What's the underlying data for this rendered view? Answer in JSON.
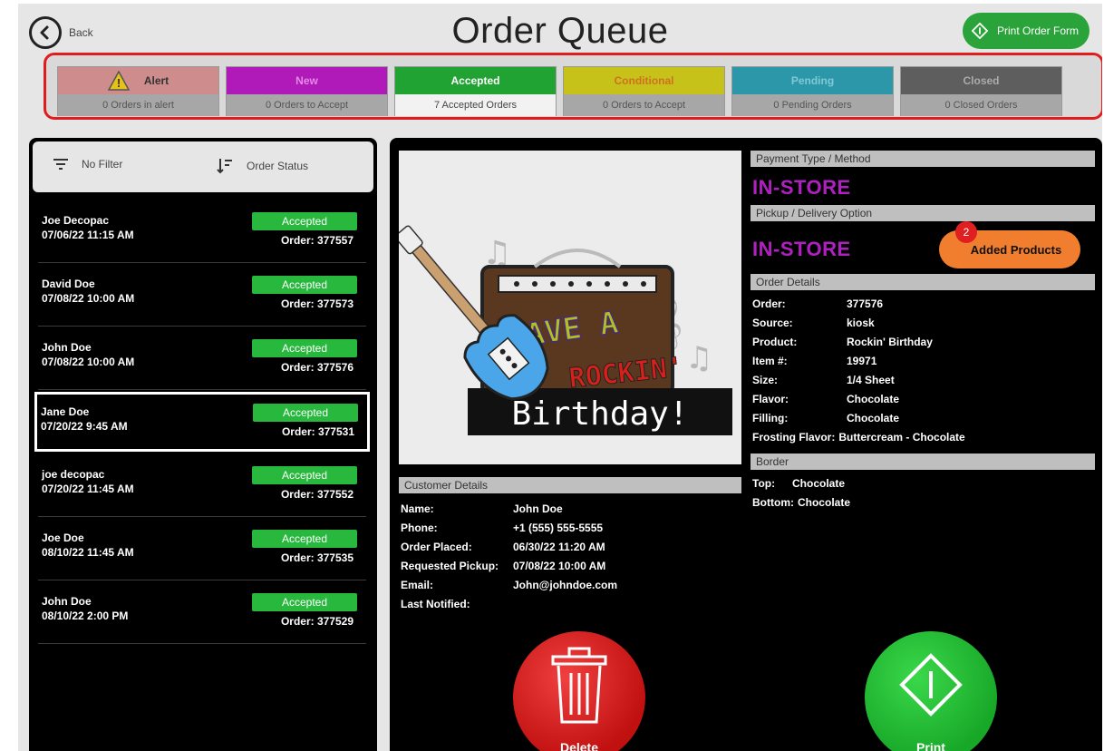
{
  "header": {
    "back_label": "Back",
    "title": "Order Queue",
    "print_form_label": "Print Order Form"
  },
  "status_tabs": [
    {
      "label": "Alert",
      "sub": "0 Orders in alert",
      "color": "#cf8c8c"
    },
    {
      "label": "New",
      "sub": "0 Orders to Accept",
      "color": "#b01ab8"
    },
    {
      "label": "Accepted",
      "sub": "7 Accepted Orders",
      "color": "#21a333"
    },
    {
      "label": "Conditional",
      "sub": "0 Orders to Accept",
      "color": "#c7c21a"
    },
    {
      "label": "Pending",
      "sub": "0 Pending Orders",
      "color": "#2c97a8"
    },
    {
      "label": "Closed",
      "sub": "0 Closed Orders",
      "color": "#5e5e5e"
    }
  ],
  "filters": {
    "filter_label": "No Filter",
    "sort_label": "Order Status"
  },
  "orders": [
    {
      "name": "Joe Decopac",
      "datetime": "07/06/22 11:15 AM",
      "status": "Accepted",
      "order": "Order: 377557"
    },
    {
      "name": "David Doe",
      "datetime": "07/08/22 10:00 AM",
      "status": "Accepted",
      "order": "Order: 377573"
    },
    {
      "name": "John Doe",
      "datetime": "07/08/22 10:00 AM",
      "status": "Accepted",
      "order": "Order: 377576"
    },
    {
      "name": "Jane Doe",
      "datetime": "07/20/22 9:45 AM",
      "status": "Accepted",
      "order": "Order: 377531"
    },
    {
      "name": "joe decopac",
      "datetime": "07/20/22 11:45 AM",
      "status": "Accepted",
      "order": "Order: 377552"
    },
    {
      "name": "Joe Doe",
      "datetime": "08/10/22 11:45 AM",
      "status": "Accepted",
      "order": "Order: 377535"
    },
    {
      "name": "John Doe",
      "datetime": "08/10/22 2:00 PM",
      "status": "Accepted",
      "order": "Order: 377529"
    }
  ],
  "selected_order_index": 3,
  "cake_image": {
    "line1": "HAVE A",
    "line2": "ROCKIN'",
    "line3": "Birthday!"
  },
  "customer": {
    "header": "Customer Details",
    "fields": [
      {
        "k": "Name:",
        "v": "John Doe"
      },
      {
        "k": "Phone:",
        "v": "+1 (555) 555-5555"
      },
      {
        "k": "Order Placed:",
        "v": "06/30/22 11:20 AM"
      },
      {
        "k": "Requested Pickup:",
        "v": "07/08/22 10:00 AM"
      },
      {
        "k": "Email:",
        "v": "John@johndoe.com"
      },
      {
        "k": "Last Notified:",
        "v": ""
      }
    ]
  },
  "payment": {
    "header": "Payment Type / Method",
    "value": "IN-STORE"
  },
  "pickup": {
    "header": "Pickup / Delivery Option",
    "value": "IN-STORE"
  },
  "added_products": {
    "label": "Added Products",
    "count": "2"
  },
  "order_details": {
    "header": "Order Details",
    "fields": [
      {
        "k": "Order:",
        "v": "377576"
      },
      {
        "k": "Source:",
        "v": "kiosk"
      },
      {
        "k": "Product:",
        "v": "Rockin' Birthday"
      },
      {
        "k": "Item #:",
        "v": "19971"
      },
      {
        "k": "Size:",
        "v": "1/4 Sheet"
      },
      {
        "k": "Flavor:",
        "v": "Chocolate"
      },
      {
        "k": "Filling:",
        "v": "Chocolate"
      }
    ],
    "frosting_label": "Frosting Flavor:",
    "frosting_value": "Buttercream - Chocolate"
  },
  "border": {
    "header": "Border",
    "fields": [
      {
        "k": "Top:",
        "v": "Chocolate"
      },
      {
        "k": "Bottom:",
        "v": "Chocolate"
      }
    ]
  },
  "actions": {
    "delete_label": "Delete",
    "print_label": "Print"
  }
}
